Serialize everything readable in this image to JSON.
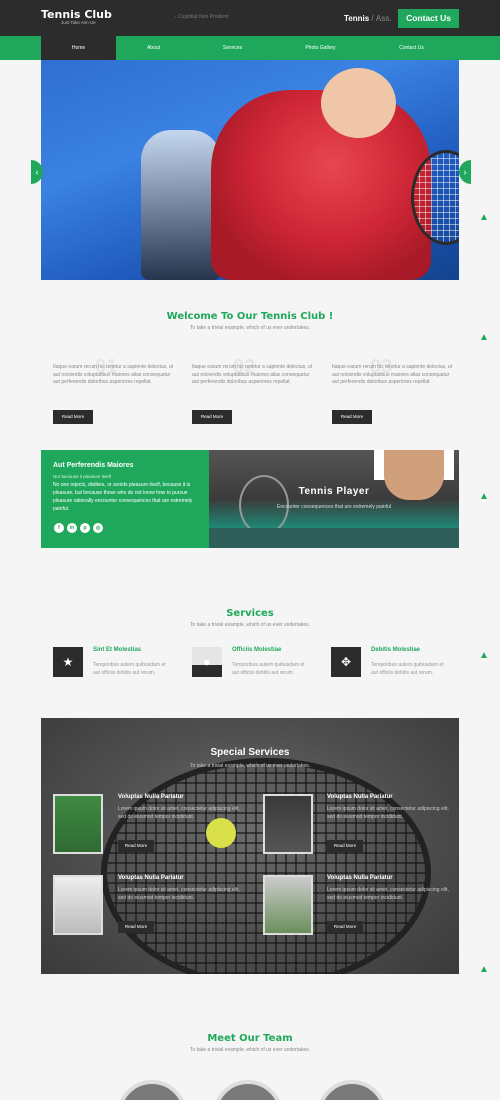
{
  "header": {
    "logo": "Tennis Club",
    "logo_sub": "Just Take Aim Ue",
    "tagline": "Cupiditat Non Proident",
    "social_a": "Tennis",
    "social_sep": "/",
    "social_b": "Ass.",
    "contact": "Contact Us"
  },
  "nav": [
    "Home",
    "About",
    "Services",
    "Photo Gallery",
    "Contact Us"
  ],
  "slider": {
    "prev": "‹",
    "next": "›"
  },
  "welcome": {
    "title": "Welcome To Our Tennis Club !",
    "subtitle": "To take a trivial example, which of us ever undertakes.",
    "columns": [
      {
        "num": "01",
        "text": "Itaque earum rerum hic tenetur a sapiente delectus, ut aut reiciendis voluptatibus maiores alias consequatur aut perferendis doloribus asperiores repellat.",
        "button": "Read More"
      },
      {
        "num": "02",
        "text": "Itaque earum rerum hic tenetur a sapiente delectus, ut aut reiciendis voluptatibus maiores alias consequatur aut perferendis doloribus asperiores repellat.",
        "button": "Read More"
      },
      {
        "num": "03",
        "text": "Itaque earum rerum hic tenetur a sapiente delectus, ut aut reiciendis voluptatibus maiores alias consequatur aut perferendis doloribus asperiores repellat.",
        "button": "Read More"
      }
    ]
  },
  "about": {
    "title": "Aut Perferendis Maiores",
    "subtitle": "Nor because it pleasure itself",
    "text": "No one rejects, dislikes, or avoids pleasure itself, because it is pleasure, but because those who do not know how to pursue pleasure rationally encounter consequences that are extremely painful.",
    "social": [
      "f",
      "in",
      "p",
      "◎"
    ],
    "player_title": "Tennis Player",
    "player_text": "Encounter consequences that are extremely painful"
  },
  "services": {
    "title": "Services",
    "subtitle": "To take a trivial example, which of us ever undertakes.",
    "items": [
      {
        "icon": "★",
        "title": "Sint Et Molestias",
        "text": "Temporibus autem quibusdam et aut officiis debitis aut rerum."
      },
      {
        "icon": "●",
        "title": "Officiis Molestiae",
        "text": "Temporibus autem quibusdam et aut officiis debitis aut rerum."
      },
      {
        "icon": "✥",
        "title": "Debitis Molestiae",
        "text": "Temporibus autem quibusdam et aut officiis debitis aut rerum."
      }
    ]
  },
  "special": {
    "title": "Special Services",
    "subtitle": "To take a trivial example, which of us ever undertakes.",
    "items": [
      {
        "title": "Voluptas Nulla Pariatur",
        "text": "Lorem ipsum dolor sit amet, consectetur adipiscing elit, sed do eiusmod tempor incididunt.",
        "button": "Read More"
      },
      {
        "title": "Voluptas Nulla Pariatur",
        "text": "Lorem ipsum dolor sit amet, consectetur adipiscing elit, sed do eiusmod tempor incididunt.",
        "button": "Read More"
      },
      {
        "title": "Voluptas Nulla Pariatur",
        "text": "Lorem ipsum dolor sit amet, consectetur adipiscing elit, sed do eiusmod tempor incididunt.",
        "button": "Read More"
      },
      {
        "title": "Voluptas Nulla Pariatur",
        "text": "Lorem ipsum dolor sit amet, consectetur adipiscing elit, sed do eiusmod tempor incididunt.",
        "button": "Read More"
      }
    ]
  },
  "team": {
    "title": "Meet Our Team",
    "subtitle": "To take a trivial example, which of us ever undertakes."
  },
  "scroll_top": "▲",
  "colors": {
    "accent": "#1fa85b",
    "dark": "#2c2c2c"
  }
}
